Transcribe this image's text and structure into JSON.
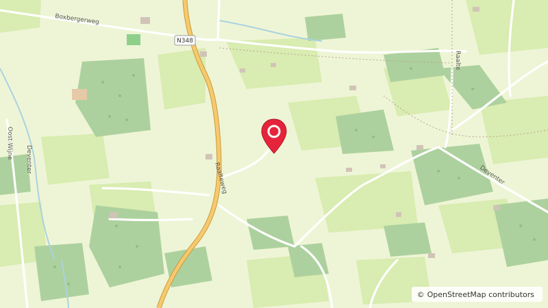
{
  "map": {
    "labels": {
      "boxbergerweg": "Boxbergerweg",
      "n348": "N348",
      "raalteweg": "Raalteweg",
      "oost_wijne": "Oost-Wijne",
      "deventer_west": "Deventer",
      "deventer_east": "Deventer",
      "raalte": "Raalte"
    },
    "colors": {
      "background": "#eef5d6",
      "field": "#d9ecb1",
      "forest": "#add19e",
      "main_road": "#f7c96f",
      "water": "#aad3df",
      "marker": "#e5243b"
    },
    "marker_icon": "map-pin-icon"
  },
  "attribution": {
    "symbol": "©",
    "text": "OpenStreetMap contributors"
  }
}
